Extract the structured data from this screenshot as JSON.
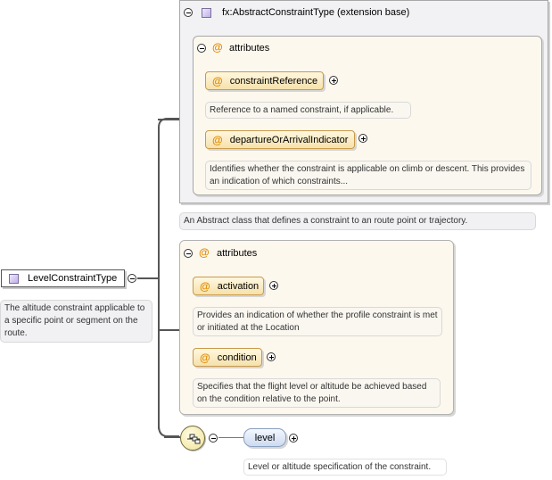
{
  "root_element": {
    "name": "LevelConstraintType",
    "description": "The altitude constraint applicable to a specific point or segment on the route."
  },
  "extension_base": {
    "label": "fx:AbstractConstraintType (extension base)",
    "attributes_label": "attributes",
    "attributes": [
      {
        "name": "constraintReference",
        "description": "Reference to a named constraint, if applicable."
      },
      {
        "name": "departureOrArrivalIndicator",
        "description": "Identifies whether the constraint is applicable on climb or descent. This provides an indication of which constraints..."
      }
    ],
    "description": "An Abstract class that defines a constraint to an route point or trajectory."
  },
  "own_attributes": {
    "label": "attributes",
    "items": [
      {
        "name": "activation",
        "description": "Provides an indication of whether the profile constraint is met or initiated at the Location"
      },
      {
        "name": "condition",
        "description": "Specifies that the flight level or altitude be achieved based on the condition relative to the point."
      }
    ]
  },
  "sequence": {
    "child": {
      "name": "level",
      "description": "Level or altitude specification of the constraint."
    }
  },
  "colors": {
    "attribute_marker": "#e08a00",
    "attribute_fill": "#f6e1aa",
    "element_fill": "#ccdaf0",
    "type_marker": "#bfb0e6",
    "connector": "#555555"
  }
}
